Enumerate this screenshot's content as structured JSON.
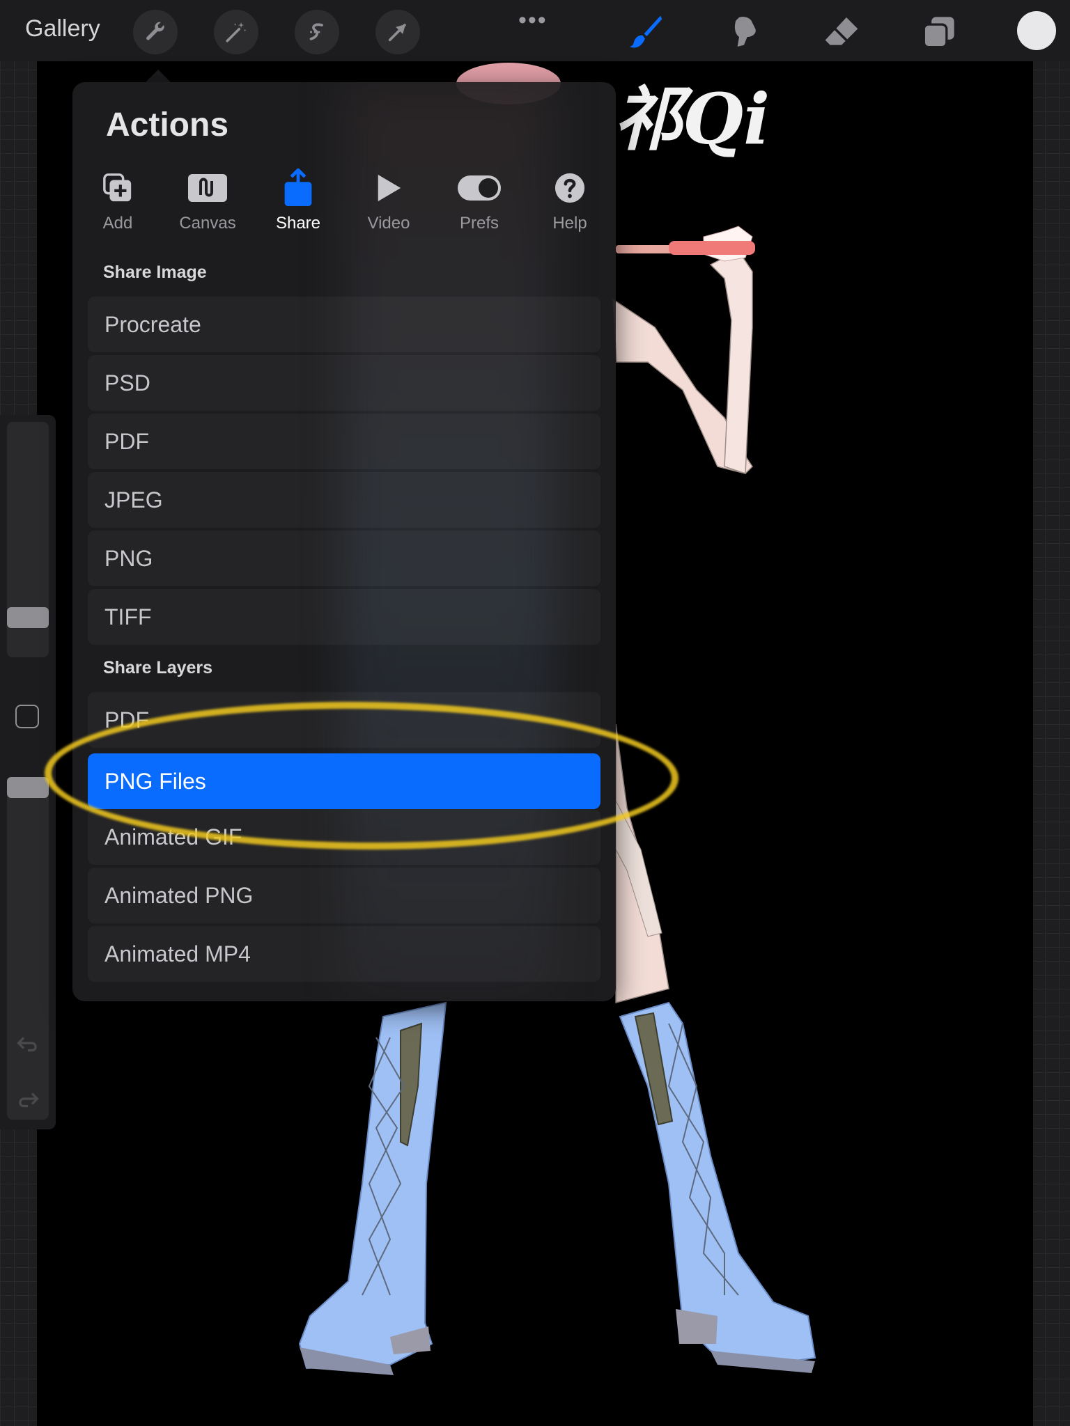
{
  "topbar": {
    "gallery_label": "Gallery",
    "more_label": "•••",
    "tools_left": [
      "wrench-icon",
      "magic-wand-icon",
      "selection-icon",
      "transform-arrow-icon"
    ],
    "tools_right": [
      "brush-icon",
      "smudge-icon",
      "eraser-icon",
      "layers-icon"
    ],
    "active_tool": "brush-icon",
    "accent_color": "#0a6cff",
    "current_color": "#e8e8ea"
  },
  "actions": {
    "title": "Actions",
    "tabs": [
      {
        "label": "Add",
        "icon": "add-icon"
      },
      {
        "label": "Canvas",
        "icon": "canvas-icon"
      },
      {
        "label": "Share",
        "icon": "share-icon"
      },
      {
        "label": "Video",
        "icon": "play-icon"
      },
      {
        "label": "Prefs",
        "icon": "toggle-icon"
      },
      {
        "label": "Help",
        "icon": "help-icon"
      }
    ],
    "active_tab": "Share",
    "share_image": {
      "heading": "Share Image",
      "items": [
        "Procreate",
        "PSD",
        "PDF",
        "JPEG",
        "PNG",
        "TIFF"
      ]
    },
    "share_layers": {
      "heading": "Share Layers",
      "items": [
        "PDF",
        "PNG Files",
        "Animated GIF",
        "Animated PNG",
        "Animated MP4"
      ],
      "selected": "PNG Files"
    }
  },
  "artwork": {
    "signature": "祁Qi"
  }
}
